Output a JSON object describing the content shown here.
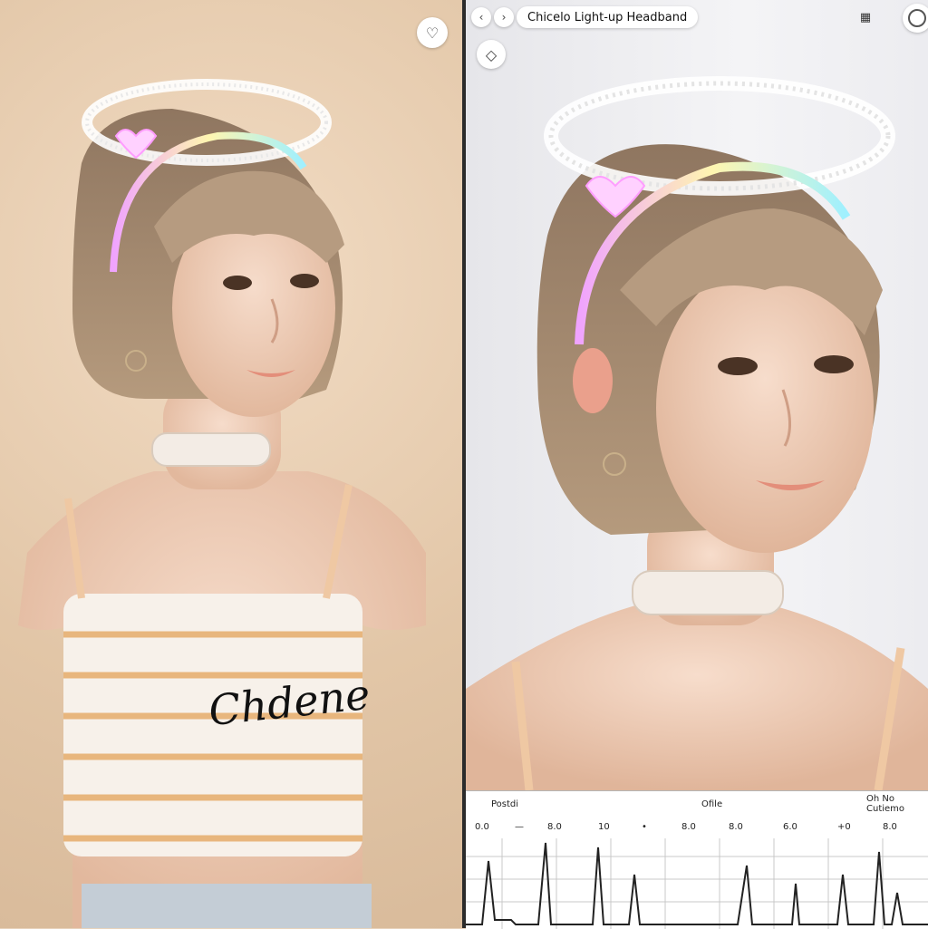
{
  "title": "Chicelo Light-up Headband",
  "shirt_text": "Chdene",
  "chart_bar": {
    "left_label": "Postdi",
    "center_label": "Ofile",
    "right_label": "Oh No Cutiemo",
    "ticks": [
      "0.0",
      "—",
      "8.0",
      "10",
      "•",
      "8.0",
      "8.0",
      "6.0",
      "+0",
      "8.0"
    ]
  },
  "icons": {
    "left_panel_button": "heart-icon",
    "back_button": "chevron-left-icon",
    "forward_button": "chevron-right-icon",
    "grid_button": "grid-icon",
    "profile_button": "circle-icon",
    "shape_button": "shape-icon"
  },
  "colors": {
    "divider": "#2b2b2b",
    "left_bg": "#e2c6a7",
    "right_bg": "#f0f0f3"
  }
}
